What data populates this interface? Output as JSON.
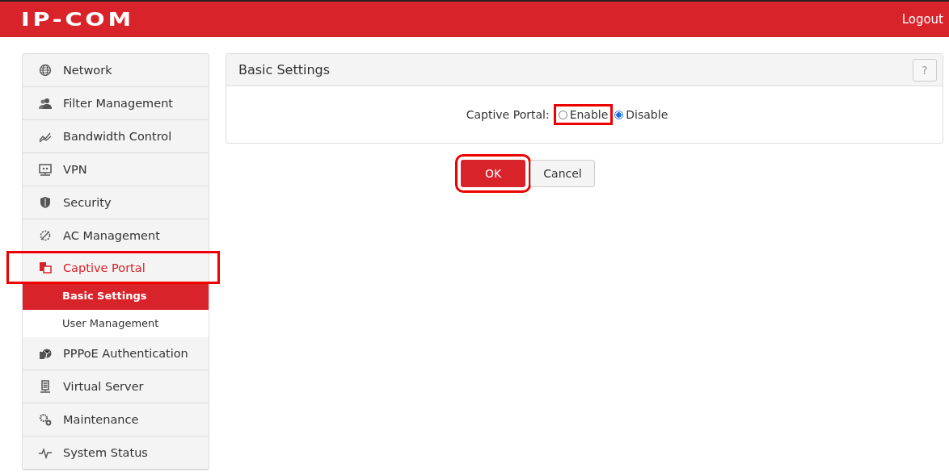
{
  "header": {
    "logo": "IP-COM",
    "logout": "Logout"
  },
  "sidebar": {
    "items": [
      {
        "label": "Network",
        "selected": false,
        "highlighted": false
      },
      {
        "label": "Filter Management",
        "selected": false,
        "highlighted": false
      },
      {
        "label": "Bandwidth Control",
        "selected": false,
        "highlighted": false
      },
      {
        "label": "VPN",
        "selected": false,
        "highlighted": false
      },
      {
        "label": "Security",
        "selected": false,
        "highlighted": false
      },
      {
        "label": "AC Management",
        "selected": false,
        "highlighted": false
      },
      {
        "label": "Captive Portal",
        "selected": true,
        "highlighted": true,
        "children": [
          {
            "label": "Basic Settings",
            "selected": true
          },
          {
            "label": "User Management",
            "selected": false
          }
        ]
      },
      {
        "label": "PPPoE Authentication",
        "selected": false,
        "highlighted": false
      },
      {
        "label": "Virtual Server",
        "selected": false,
        "highlighted": false
      },
      {
        "label": "Maintenance",
        "selected": false,
        "highlighted": false
      },
      {
        "label": "System Status",
        "selected": false,
        "highlighted": false
      }
    ]
  },
  "panel": {
    "title": "Basic Settings",
    "help": "?",
    "field": {
      "label": "Captive Portal:",
      "options": [
        {
          "label": "Enable",
          "selected": false,
          "highlighted": true
        },
        {
          "label": "Disable",
          "selected": true,
          "highlighted": false
        }
      ]
    }
  },
  "buttons": [
    {
      "label": "OK",
      "kind": "primary",
      "highlighted": true
    },
    {
      "label": "Cancel",
      "kind": "secondary",
      "highlighted": false
    }
  ]
}
